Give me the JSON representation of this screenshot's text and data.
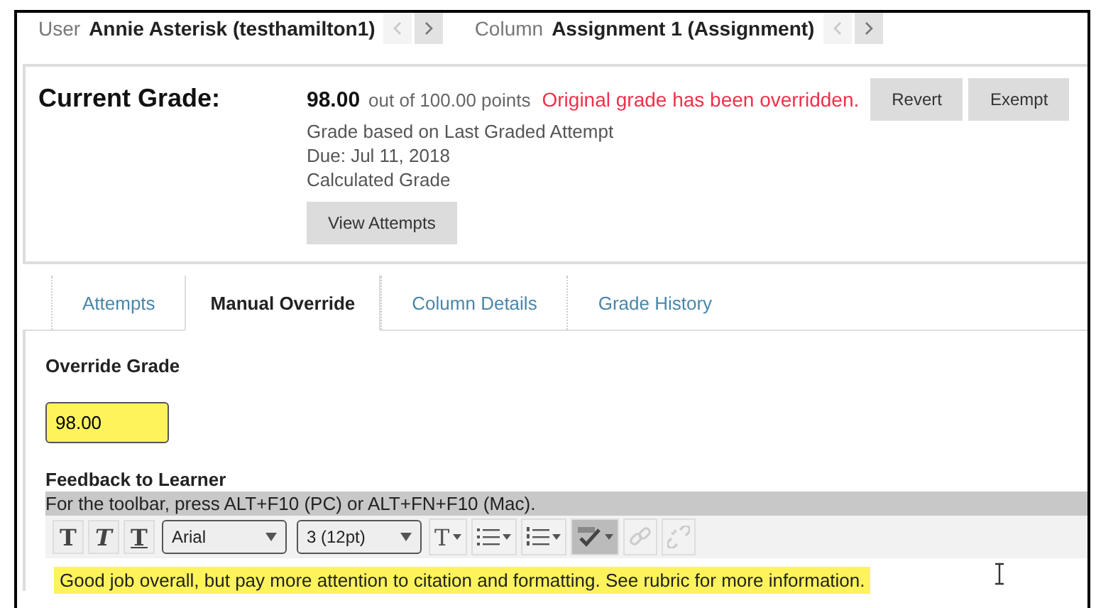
{
  "header": {
    "user_label": "User",
    "user_name": "Annie Asterisk (testhamilton1)",
    "user_nav": [
      {
        "kind": "prev",
        "disabled": true
      },
      {
        "kind": "next",
        "disabled": false
      }
    ],
    "column_label": "Column",
    "column_name": "Assignment 1 (Assignment)",
    "column_nav": [
      {
        "kind": "prev",
        "disabled": true
      },
      {
        "kind": "next",
        "disabled": false
      }
    ]
  },
  "grade_panel": {
    "title": "Current Grade:",
    "score": "98.00",
    "out_of": "out of 100.00 points",
    "notice": "Original grade has been overridden.",
    "details": [
      "Grade based on Last Graded Attempt",
      "Due: Jul 11, 2018",
      "Calculated Grade"
    ],
    "view_button": "View Attempts",
    "buttons": [
      "Revert",
      "Exempt"
    ]
  },
  "tabs": [
    {
      "label": "Attempts",
      "selected": false
    },
    {
      "label": "Manual Override",
      "selected": true
    },
    {
      "label": "Column Details",
      "selected": false
    },
    {
      "label": "Grade History",
      "selected": false
    }
  ],
  "override": {
    "label": "Override Grade",
    "value": "98.00"
  },
  "feedback": {
    "label": "Feedback to Learner",
    "toolbar_hint": "For the toolbar, press ALT+F10 (PC) or ALT+FN+F10 (Mac).",
    "toolbar": [
      {
        "kind": "bold",
        "label": "T"
      },
      {
        "kind": "italic",
        "label": "T"
      },
      {
        "kind": "underline",
        "label": "T"
      },
      {
        "kind": "select",
        "value": "Arial"
      },
      {
        "kind": "select",
        "value": "3 (12pt)"
      },
      {
        "kind": "color",
        "label": "T"
      },
      {
        "kind": "bullets"
      },
      {
        "kind": "numbers"
      },
      {
        "kind": "spellcheck",
        "selected": true
      },
      {
        "kind": "link",
        "disabled": true
      },
      {
        "kind": "unlink",
        "disabled": true
      }
    ],
    "text": "Good job overall, but pay more attention to citation and formatting. See rubric for more information."
  }
}
